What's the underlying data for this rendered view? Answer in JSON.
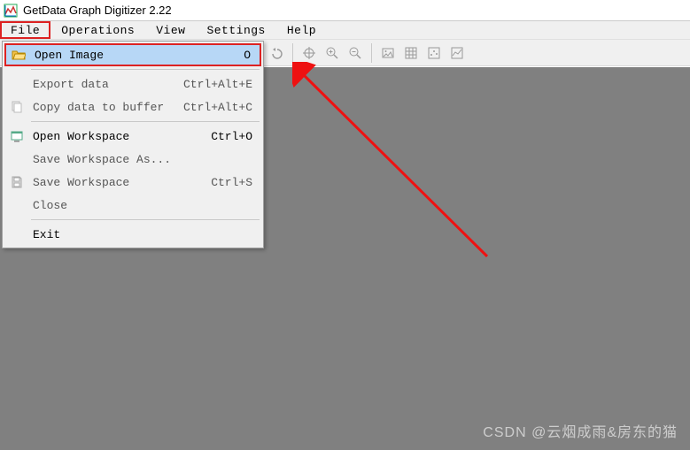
{
  "titlebar": {
    "title": "GetData Graph Digitizer 2.22"
  },
  "menubar": {
    "items": [
      {
        "label": "File",
        "active": true
      },
      {
        "label": "Operations",
        "active": false
      },
      {
        "label": "View",
        "active": false
      },
      {
        "label": "Settings",
        "active": false
      },
      {
        "label": "Help",
        "active": false
      }
    ]
  },
  "toolbar": {
    "icons": [
      "undo-icon",
      "|",
      "target-icon",
      "zoom-in-icon",
      "zoom-out-icon",
      "|",
      "image-icon",
      "grid-icon",
      "points-icon",
      "chart-icon"
    ]
  },
  "file_menu": {
    "items": [
      {
        "icon": "open-folder-icon",
        "label": "Open Image",
        "shortcut": "O",
        "enabled": true,
        "highlight": true
      },
      {
        "rule": true
      },
      {
        "icon": "",
        "label": "Export data",
        "shortcut": "Ctrl+Alt+E",
        "enabled": false,
        "highlight": false
      },
      {
        "icon": "copy-icon",
        "label": "Copy data to buffer",
        "shortcut": "Ctrl+Alt+C",
        "enabled": false,
        "highlight": false
      },
      {
        "rule": true
      },
      {
        "icon": "workspace-icon",
        "label": "Open Workspace",
        "shortcut": "Ctrl+O",
        "enabled": true,
        "highlight": false
      },
      {
        "icon": "",
        "label": "Save Workspace As...",
        "shortcut": "",
        "enabled": false,
        "highlight": false
      },
      {
        "icon": "save-icon",
        "label": "Save Workspace",
        "shortcut": "Ctrl+S",
        "enabled": false,
        "highlight": false
      },
      {
        "icon": "",
        "label": "Close",
        "shortcut": "",
        "enabled": false,
        "highlight": false
      },
      {
        "rule": true
      },
      {
        "icon": "",
        "label": "Exit",
        "shortcut": "",
        "enabled": true,
        "highlight": false
      }
    ]
  },
  "watermark": "CSDN @云烟成雨&房东的猫"
}
